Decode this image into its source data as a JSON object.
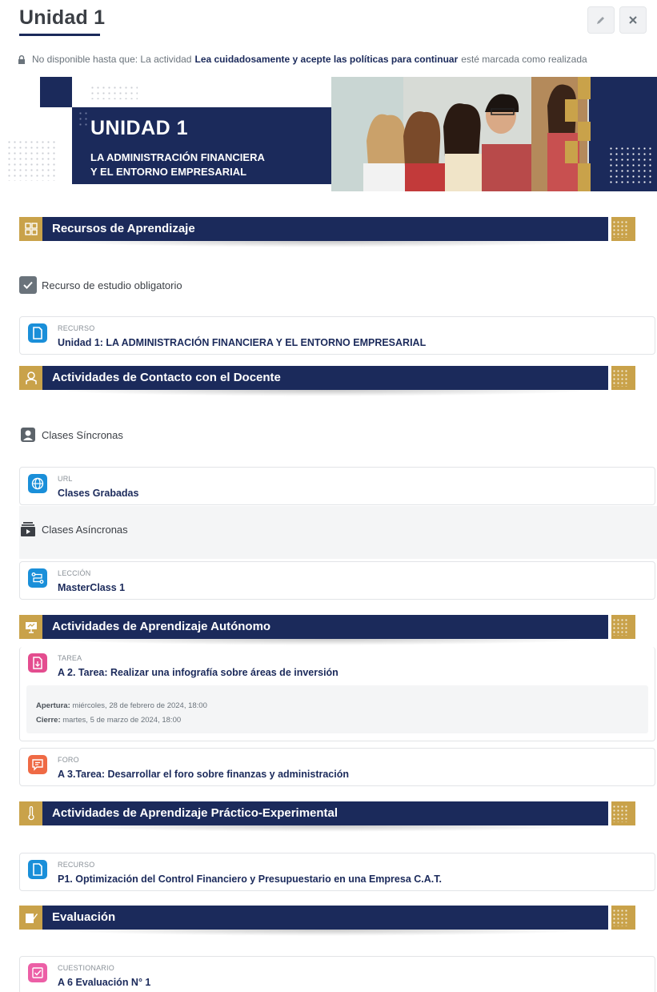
{
  "header": {
    "title": "Unidad 1",
    "edit_icon": "pencil-icon",
    "close_icon": "close-icon"
  },
  "restriction": {
    "prefix": "No disponible hasta que: La actividad",
    "activity": "Lea cuidadosamente y acepte las políticas para continuar",
    "suffix": "esté marcada como realizada"
  },
  "banner": {
    "title": "UNIDAD 1",
    "subtitle_line1": "LA ADMINISTRACIÓN FINANCIERA",
    "subtitle_line2": "Y EL ENTORNO EMPRESARIAL"
  },
  "colors": {
    "navy": "#1b2a5b",
    "gold": "#c9a24a",
    "resource_blue": "#1a8fd9",
    "assignment_pink": "#e44d8f",
    "forum_orange": "#ef6a45",
    "quiz_pink": "#ec5fa6"
  },
  "sections": [
    {
      "title": "Recursos de Aprendizaje",
      "icon": "resources-grid-icon",
      "subheadings": [
        {
          "label": "Recurso de estudio obligatorio",
          "icon": "checkbox-icon"
        }
      ],
      "activities": [
        {
          "type": "RECURSO",
          "name": "Unidad 1: LA ADMINISTRACIÓN FINANCIERA Y EL ENTORNO EMPRESARIAL",
          "icon": "file-icon"
        }
      ]
    },
    {
      "title": "Actividades de Contacto con el Docente",
      "icon": "person-icon",
      "subheadings": [
        {
          "label": "Clases Síncronas",
          "icon": "user-square-icon"
        },
        {
          "label": "Clases Asíncronas",
          "icon": "video-stack-icon"
        }
      ],
      "activities": [
        {
          "type": "URL",
          "name": "Clases Grabadas",
          "icon": "globe-icon"
        },
        {
          "type": "LECCIÓN",
          "name": "MasterClass 1",
          "icon": "lesson-icon"
        }
      ]
    },
    {
      "title": "Actividades de Aprendizaje Autónomo",
      "icon": "presentation-icon",
      "activities": [
        {
          "type": "TAREA",
          "name": "A 2. Tarea: Realizar una infografía sobre áreas de inversión",
          "icon": "assignment-icon",
          "opening_label": "Apertura:",
          "opening": "miércoles, 28 de febrero de 2024, 18:00",
          "closing_label": "Cierre:",
          "closing": "martes, 5 de marzo de 2024, 18:00"
        },
        {
          "type": "FORO",
          "name": "A 3.Tarea: Desarrollar el foro sobre finanzas y administración",
          "icon": "forum-icon"
        }
      ]
    },
    {
      "title": "Actividades de Aprendizaje Práctico-Experimental",
      "icon": "thermometer-icon",
      "activities": [
        {
          "type": "RECURSO",
          "name": "P1. Optimización del Control Financiero y Presupuestario en una Empresa C.A.T.",
          "icon": "file-icon"
        }
      ]
    },
    {
      "title": "Evaluación",
      "icon": "edit-note-icon",
      "activities": [
        {
          "type": "CUESTIONARIO",
          "name": "A 6 Evaluación N° 1",
          "icon": "quiz-icon"
        }
      ]
    }
  ]
}
